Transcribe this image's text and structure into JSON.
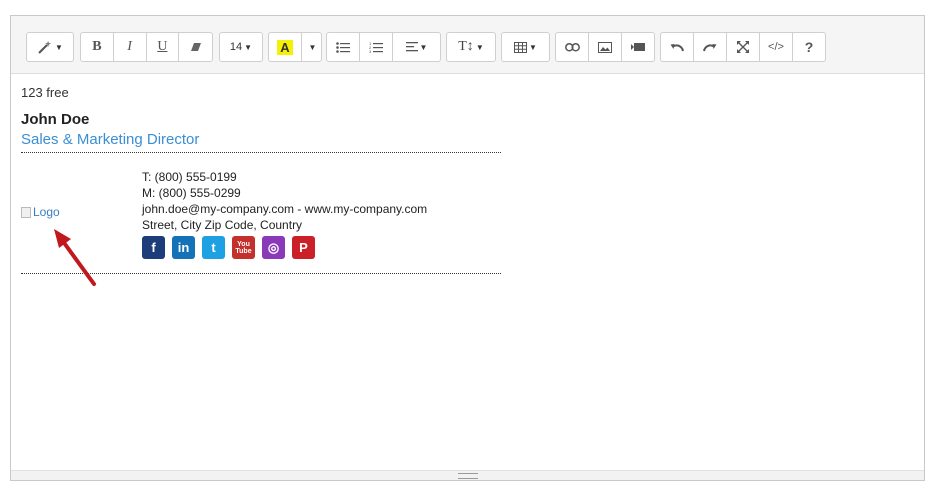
{
  "toolbar": {
    "font_size": "14",
    "highlight_letter": "A",
    "highlight_color": "#f5f006"
  },
  "signature": {
    "top_note": "123 free",
    "name": "John Doe",
    "title": "Sales & Marketing Director",
    "logo_alt": "Logo",
    "phone": "T: (800) 555-0199",
    "mobile": "M: (800) 555-0299",
    "email_web": "john.doe@my-company.com - www.my-company.com",
    "address": "Street, City Zip Code, Country",
    "social": [
      {
        "icon": "facebook-icon",
        "glyph": "f",
        "color": "#1d3c7a"
      },
      {
        "icon": "linkedin-icon",
        "glyph": "in",
        "color": "#1572b6"
      },
      {
        "icon": "twitter-icon",
        "glyph": "t",
        "color": "#1da1e2"
      },
      {
        "icon": "youtube-icon",
        "glyph": "You Tube",
        "color": "#c4302b"
      },
      {
        "icon": "instagram-icon",
        "glyph": "◎",
        "color": "#8a3ab9"
      },
      {
        "icon": "pinterest-icon",
        "glyph": "P",
        "color": "#cb2027"
      }
    ]
  },
  "colors": {
    "title": "#3b8ed4",
    "arrow": "#c0181d"
  }
}
